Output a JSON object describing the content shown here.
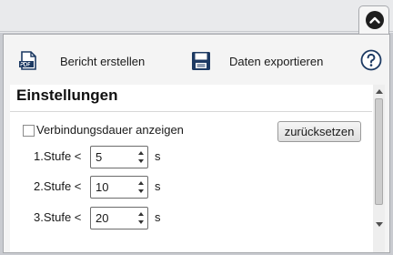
{
  "toolbar": {
    "report_label": "Bericht erstellen",
    "export_label": "Daten exportieren",
    "report_icon": "pdf-icon",
    "export_icon": "floppy-disk-icon",
    "help_icon": "help-icon"
  },
  "collapse": {
    "icon": "chevron-up-icon"
  },
  "settings": {
    "title": "Einstellungen",
    "show_duration_label": "Verbindungsdauer anzeigen",
    "show_duration_checked": false,
    "reset_label": "zurücksetzen",
    "levels": [
      {
        "label": "1.Stufe <",
        "value": "5",
        "unit": "s"
      },
      {
        "label": "2.Stufe <",
        "value": "10",
        "unit": "s"
      },
      {
        "label": "3.Stufe <",
        "value": "20",
        "unit": "s"
      }
    ]
  },
  "colors": {
    "panel_bg": "#f4f4f4",
    "content_bg": "#ffffff",
    "backdrop": "#c9cbd0",
    "icon_dark_blue": "#1d3a63"
  }
}
